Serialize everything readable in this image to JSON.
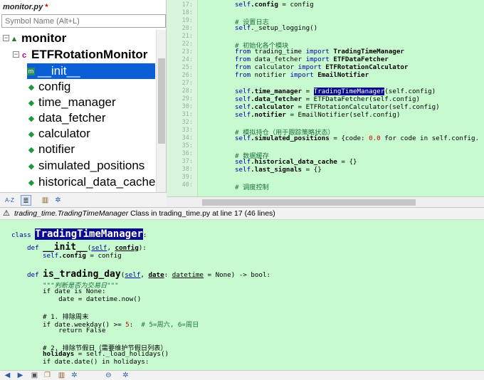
{
  "outline": {
    "tab_title": "monitor.py",
    "dirty_mark": "*",
    "filter_placeholder": "Symbol Name (Alt+L)",
    "items": [
      {
        "label": "monitor",
        "icon": "module-icon"
      },
      {
        "label": "ETFRotationMonitor",
        "icon": "class-icon"
      },
      {
        "label": "__init__",
        "icon": "method-icon"
      },
      {
        "label": "config",
        "icon": "attribute-icon"
      },
      {
        "label": "time_manager",
        "icon": "attribute-icon"
      },
      {
        "label": "data_fetcher",
        "icon": "attribute-icon"
      },
      {
        "label": "calculator",
        "icon": "attribute-icon"
      },
      {
        "label": "notifier",
        "icon": "attribute-icon"
      },
      {
        "label": "simulated_positions",
        "icon": "attribute-icon"
      },
      {
        "label": "historical_data_cache",
        "icon": "attribute-icon"
      }
    ],
    "toolbar": [
      "sort-az-icon",
      "list-view-icon",
      "book-icon",
      "gear-icon"
    ],
    "sort_label": "A-Z"
  },
  "editor": {
    "line_numbers": [
      "17:",
      "18:",
      "19:",
      "20:",
      "21:",
      "22:",
      "23:",
      "24:",
      "25:",
      "26:",
      "27:",
      "28:",
      "29:",
      "30:",
      "31:",
      "32:",
      "33:",
      "34:",
      "35:",
      "36:",
      "37:",
      "38:",
      "39:",
      "40:"
    ],
    "lines": {
      "l17a": "self",
      "l17b": ".config",
      "l17c": " = config",
      "l19": "# 设置日志",
      "l20a": "self",
      "l20b": "._setup_logging()",
      "l22": "# 初始化各个模块",
      "l23a": "from",
      "l23b": " trading_time ",
      "l23c": "import",
      "l23d": " TradingTimeManager",
      "l24a": "from",
      "l24b": " data_fetcher ",
      "l24c": "import",
      "l24d": " ETFDataFetcher",
      "l25a": "from",
      "l25b": " calculator ",
      "l25c": "import",
      "l25d": " ETFRotationCalculator",
      "l26a": "from",
      "l26b": " notifier ",
      "l26c": "import",
      "l26d": " EmailNotifier",
      "l28a": "self",
      "l28b": ".time_manager",
      "l28c": " = ",
      "l28d": "TradingTimeManager",
      "l28e": "(self.config)",
      "l29a": "self",
      "l29b": ".data_fetcher",
      "l29c": " = ETFDataFetcher(self.config)",
      "l30a": "self",
      "l30b": ".calculator",
      "l30c": " = ETFRotationCalculator(self.config)",
      "l31a": "self",
      "l31b": ".notifier",
      "l31c": " = EmailNotifier(self.config)",
      "l33": "# 模拟持仓（用于跟踪策略状态）",
      "l34a": "self",
      "l34b": ".simulated_positions",
      "l34c": " = {code: ",
      "l34d": "0.0",
      "l34e": " for code in self.config.",
      "l36": "# 数据缓存",
      "l37a": "self",
      "l37b": ".historical_data_cache",
      "l37c": " = {}",
      "l38a": "self",
      "l38b": ".last_signals",
      "l38c": " = {}",
      "l40": "# 调度控制"
    }
  },
  "doc_header": {
    "title": "trading_time.TradingTimeManager",
    "info": " Class in trading_time.py at line 17 (46 lines)"
  },
  "doc": {
    "class_kw": "class ",
    "class_name": "TradingTimeManager",
    "colon": ":",
    "def1_kw": "def ",
    "def1_name": "__init__",
    "def1_args_a": "(",
    "def1_self": "self",
    "def1_sep": ", ",
    "def1_config": "config",
    "def1_end": "):",
    "l3a": "self",
    "l3b": ".config",
    "l3c": " = config",
    "def2_kw": "def ",
    "def2_name": "is_trading_day",
    "def2_a": "(",
    "def2_self": "self",
    "def2_b": ", ",
    "def2_date": "date",
    "def2_c": ": ",
    "def2_type": "datetime",
    "def2_d": " = None) -> bool:",
    "docstring": "\"\"\"判断是否为交易日\"\"\"",
    "l7": "if date is None:",
    "l8": "    date = datetime.now()",
    "c1": "# 1. 排除周末",
    "l11a": "if date.weekday() >= ",
    "l11b": "5",
    "l11c": ":  ",
    "l11d": "# 5=周六, 6=周日",
    "l12": "    return False",
    "c2": "# 2. 排除节假日（需要维护节假日列表）",
    "l15a": "holidays",
    "l15b": " = self._load_holidays()",
    "l16": "if date.date() in holidays:"
  },
  "bottom_toolbar": [
    "back-icon",
    "forward-icon",
    "save-icon",
    "copy-icon",
    "book-icon",
    "settings-icon",
    "lock-icon",
    "gear-icon"
  ]
}
